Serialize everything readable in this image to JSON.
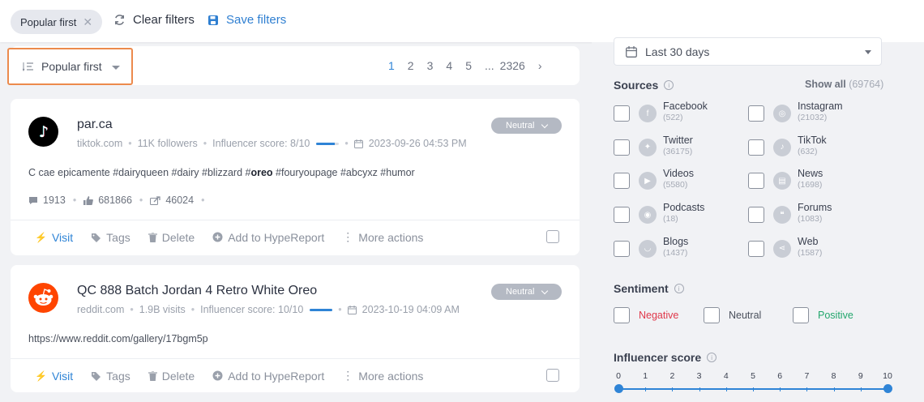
{
  "topbar": {
    "chip_label": "Popular first",
    "chip_close": "✕",
    "clear_label": "Clear filters",
    "save_label": "Save filters"
  },
  "sort": {
    "label": "Popular first"
  },
  "pagination": {
    "pages": [
      "1",
      "2",
      "3",
      "4",
      "5",
      "...",
      "2326"
    ],
    "next": "›",
    "current": "1"
  },
  "posts": [
    {
      "title": "par.ca",
      "platform": "tiktok",
      "source": "tiktok.com",
      "reach": "11K followers",
      "influencer_score": "Influencer score: 8/10",
      "influencer_score_value": 0.8,
      "date": "2023-09-26 04:53 PM",
      "sentiment": "Neutral",
      "text_before": "C cae epicamente #dairyqueen #dairy #blizzard #",
      "text_bold": "oreo",
      "text_after": " #fouryoupage #abcyxz #humor",
      "comments": "1913",
      "likes": "681866",
      "shares": "46024"
    },
    {
      "title": "QC 888 Batch Jordan 4 Retro White Oreo",
      "platform": "reddit",
      "source": "reddit.com",
      "reach": "1.9B visits",
      "influencer_score": "Influencer score: 10/10",
      "influencer_score_value": 1.0,
      "date": "2023-10-19 04:09 AM",
      "sentiment": "Neutral",
      "text": "https://www.reddit.com/gallery/17bgm5p"
    }
  ],
  "actions": {
    "visit": "Visit",
    "tags": "Tags",
    "delete": "Delete",
    "hype": "Add to HypeReport",
    "more": "More actions"
  },
  "filters": {
    "date_range": "Last 30 days",
    "sources_title": "Sources",
    "show_all": "Show all",
    "show_all_count": "(69764)",
    "sources": [
      {
        "name": "Facebook",
        "count": "(522)",
        "icon": "facebook-icon"
      },
      {
        "name": "Instagram",
        "count": "(21032)",
        "icon": "instagram-icon"
      },
      {
        "name": "Twitter",
        "count": "(36175)",
        "icon": "twitter-icon"
      },
      {
        "name": "TikTok",
        "count": "(632)",
        "icon": "tiktok-icon"
      },
      {
        "name": "Videos",
        "count": "(5580)",
        "icon": "video-icon"
      },
      {
        "name": "News",
        "count": "(1698)",
        "icon": "news-icon"
      },
      {
        "name": "Podcasts",
        "count": "(18)",
        "icon": "podcast-icon"
      },
      {
        "name": "Forums",
        "count": "(1083)",
        "icon": "forum-icon"
      },
      {
        "name": "Blogs",
        "count": "(1437)",
        "icon": "rss-icon"
      },
      {
        "name": "Web",
        "count": "(1587)",
        "icon": "share-icon"
      }
    ],
    "sentiment_title": "Sentiment",
    "sentiment": {
      "negative": "Negative",
      "neutral": "Neutral",
      "positive": "Positive"
    },
    "influencer_title": "Influencer score",
    "influencer_ticks": [
      "0",
      "1",
      "2",
      "3",
      "4",
      "5",
      "6",
      "7",
      "8",
      "9",
      "10"
    ],
    "influencer_range": [
      0,
      10
    ]
  },
  "colors": {
    "accent": "#2f84d6",
    "highlight_border": "#ec8a4c",
    "negative": "#e0384a",
    "positive": "#22a66c"
  }
}
